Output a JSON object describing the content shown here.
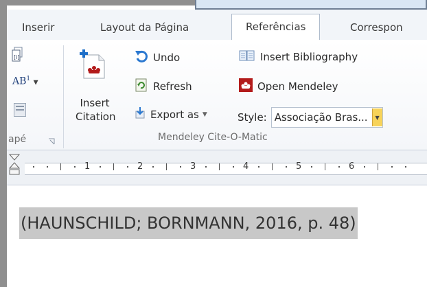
{
  "tabs": [
    {
      "label": "Inserir",
      "active": false
    },
    {
      "label": "Layout da Página",
      "active": false
    },
    {
      "label": "Referências",
      "active": true
    },
    {
      "label": "Correspon",
      "active": false
    }
  ],
  "left_group": {
    "insert_footnote_label": "AB",
    "footnote_superscript": "1",
    "label": "apé"
  },
  "mendeley": {
    "insert_citation_line1": "Insert",
    "insert_citation_line2": "Citation",
    "undo": "Undo",
    "refresh": "Refresh",
    "export_as": "Export as",
    "insert_bibliography": "Insert Bibliography",
    "open_mendeley": "Open Mendeley",
    "style_label": "Style:",
    "style_value": "Associação Bras...",
    "group_label": "Mendeley Cite-O-Matic",
    "brand_color": "#b31b1b"
  },
  "ruler": {
    "numbers": [
      "1",
      "2",
      "3",
      "4",
      "5",
      "6"
    ]
  },
  "document": {
    "citation_text": "(HAUNSCHILD; BORNMANN, 2016, p. 48)"
  }
}
